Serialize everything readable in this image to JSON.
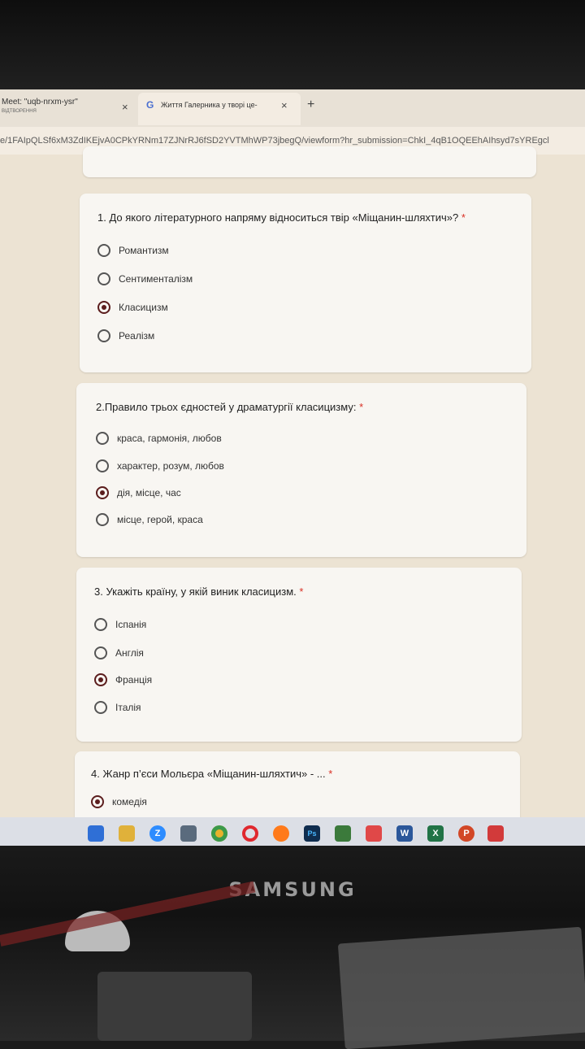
{
  "browser": {
    "tabs": [
      {
        "title": "Meet: \"uqb-nrxm-ysr\"",
        "subtitle": "ВІДТВОРЕННЯ",
        "close": "×"
      },
      {
        "icon": "G",
        "title": "Життя Галерника у творі це-",
        "close": "×"
      }
    ],
    "new_tab": "+",
    "url": "e/1FAIpQLSf6xM3ZdIKEjvA0CPkYRNm17ZJNrRJ6fSD2YVTMhWP73jbegQ/viewform?hr_submission=ChkI_4qB1OQEEhAIhsyd7sYREgcl"
  },
  "form": {
    "required_mark": "*",
    "questions": [
      {
        "title": "1. До якого літературного напряму відноситься твір «Міщанин-шляхтич»?",
        "options": [
          "Романтизм",
          "Сентименталізм",
          "Класицизм",
          "Реалізм"
        ],
        "selected": "Класицизм"
      },
      {
        "title": "2.Правило трьох єдностей у драматургії класицизму:",
        "options": [
          "краса, гармонія, любов",
          "характер, розум, любов",
          "дія, місце, час",
          "місце, герой, краса"
        ],
        "selected": "дія, місце, час"
      },
      {
        "title": "3. Укажіть країну, у якій виник класицизм.",
        "options": [
          "Іспанія",
          "Англія",
          "Франція",
          "Італія"
        ],
        "selected": "Франція"
      },
      {
        "title": "4. Жанр п’єси Мольєра «Міщанин-шляхтич» - ...",
        "options": [
          "комедія"
        ],
        "selected": "комедія"
      }
    ]
  },
  "taskbar": {
    "icons": [
      "windows-icon",
      "file-explorer-icon",
      "zoom-icon",
      "calculator-icon",
      "chrome-icon",
      "opera-icon",
      "firefox-icon",
      "photoshop-icon",
      "solitaire-icon",
      "paint-icon",
      "word-icon",
      "excel-icon",
      "powerpoint-icon",
      "snipping-tool-icon"
    ],
    "labels": {
      "zoom": "Z",
      "photoshop": "Ps",
      "word": "W",
      "excel": "X",
      "powerpoint": "P"
    }
  },
  "monitor": {
    "brand": "SAMSUNG"
  }
}
